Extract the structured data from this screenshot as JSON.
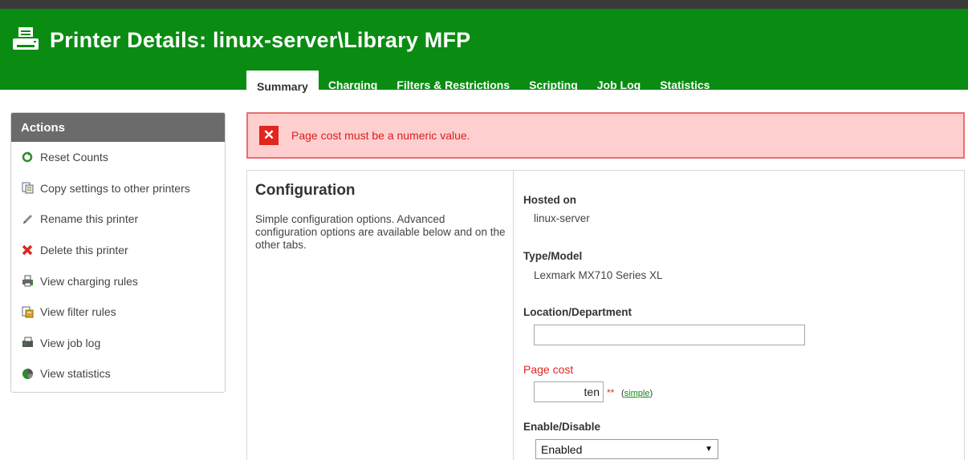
{
  "colors": {
    "header_green": "#0a8c12",
    "error_red": "#e0261d",
    "error_bg": "#ffcfcf"
  },
  "header": {
    "title": "Printer Details: linux-server\\Library MFP",
    "icon": "printer-icon"
  },
  "tabs": [
    {
      "label": "Summary",
      "active": true
    },
    {
      "label": "Charging"
    },
    {
      "label": "Filters & Restrictions"
    },
    {
      "label": "Scripting"
    },
    {
      "label": "Job Log"
    },
    {
      "label": "Statistics"
    }
  ],
  "sidebar": {
    "title": "Actions",
    "items": [
      {
        "label": "Reset Counts",
        "icon": "refresh-icon"
      },
      {
        "label": "Copy settings to other printers",
        "icon": "copy-icon"
      },
      {
        "label": "Rename this printer",
        "icon": "pencil-icon"
      },
      {
        "label": "Delete this printer",
        "icon": "delete-x-icon"
      },
      {
        "label": "View charging rules",
        "icon": "printer-icon"
      },
      {
        "label": "View filter rules",
        "icon": "filter-icon"
      },
      {
        "label": "View job log",
        "icon": "job-log-icon"
      },
      {
        "label": "View statistics",
        "icon": "pie-chart-icon"
      }
    ]
  },
  "error": {
    "message": "Page cost must be a numeric value."
  },
  "config": {
    "title": "Configuration",
    "description": "Simple configuration options. Advanced configuration options are available below and on the other tabs.",
    "hosted_on_label": "Hosted on",
    "hosted_on_value": "linux-server",
    "type_model_label": "Type/Model",
    "type_model_value": "Lexmark MX710 Series XL",
    "location_label": "Location/Department",
    "location_value": "",
    "page_cost_label": "Page cost",
    "page_cost_value": "ten",
    "page_cost_required": "**",
    "simple_open": "(",
    "simple_link": "simple",
    "simple_close": ")",
    "enable_label": "Enable/Disable",
    "enable_value": "Enabled"
  }
}
